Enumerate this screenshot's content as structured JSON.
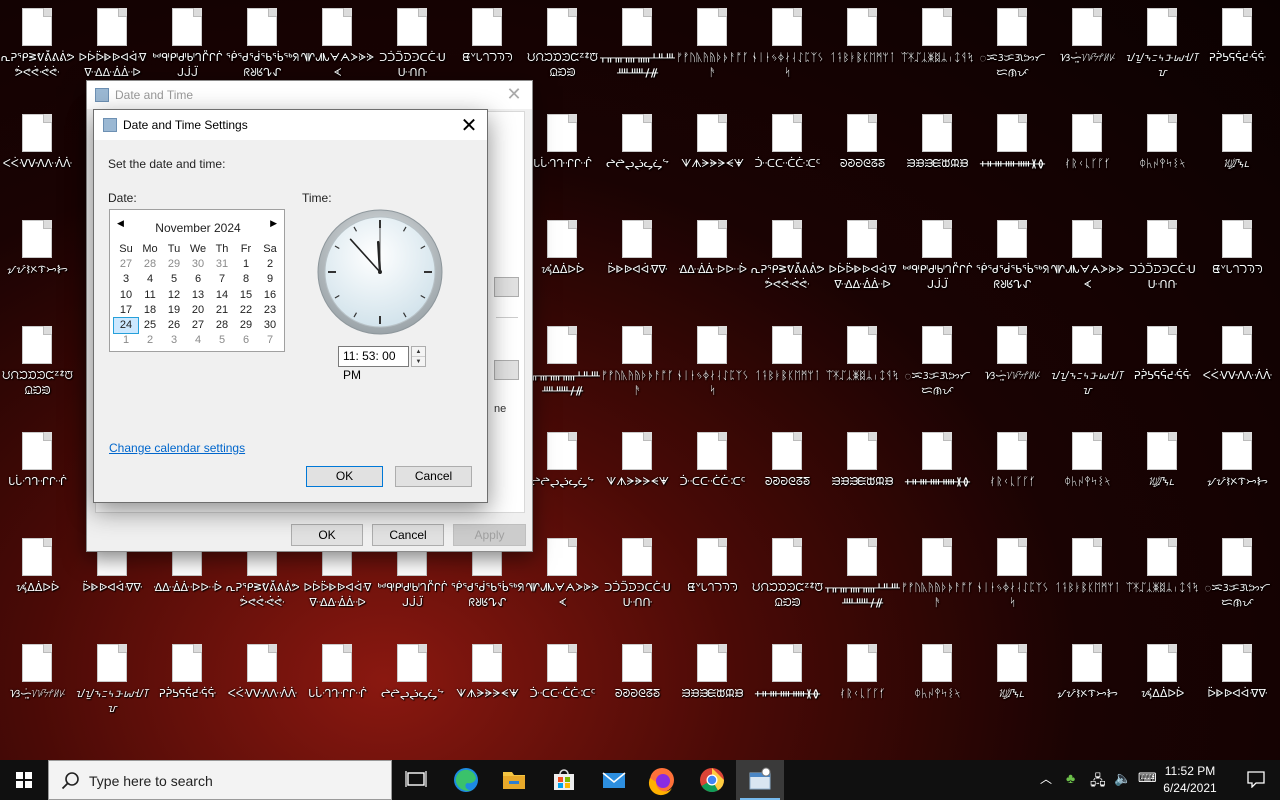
{
  "desktop": {
    "icon_labels": [
      "ᕆᕈᕿᕒᕓᕔᕕᕖᕗᕘᕙᕚᕛᕜ",
      "ᐅᐆᐇᐈᐉᐊᐋᐌᐍᐎᐏᐐᐑᐒ",
      "ᒃᒄᒅᒆᒇᒈᒉᒊᒋᒌᒍᒎᒏ",
      "ᖀᖁᖂᖃᖄᖅᖆᖇᖈᖉᖊᖋ",
      "ᗀᗁᗂᗃᗄᗅᗆᗇᗈᗉ",
      "ᑐᑑᑒᑓᑔᑕᑖᑗᑘᑙᑚ",
      "ᘀᘁᘂᘃᘄᘅᘆ",
      "ᙀᙁᙂᙃᙄᙅᙆᙇᙈᙉᙊᙋ",
      "ᚁᚂᚃᚄᚅᚆᚇᚈᚉᚊᚋᚌ",
      "ᚠᚡᚢᚣᚤᚥᚦᚧᚨᚩᚪᚫ",
      "ᛀᛁᛂᛃᛄᛅᛆᛇᛈᛉᛊᛋ",
      "ᛐᛑᛒᛓᛔᛕᛖᛗᛘᛙ",
      "ᛠᛡᛢᛣᛤᛥᛦᛧᛨᛩᛪ",
      "ᜀᜁᜂᜃᜄᜅᜆᜇᜈᜉ",
      "ᜐᜑᜒᜓ᜔ᜠᜡᜢᜣᜤᜥ",
      "ᝀᝁᝂᝃᝄᝅᝆᝇᝈᝉ",
      "ᕈᕉᕊᕋᕌᕍᕎᕏ",
      "ᐸᐹᐺᐻᐼᐽᐾᐿ",
      "ᒐᒑᒒᒓᒔᒕᒖ",
      "ᖠᖡᖢᖣᖤᖥᖦ",
      "ᗐᗑᗒᗓᗔᗕᗖ",
      "ᑠᑡᑢᑣᑤᑥᑦ",
      "ᘐᘑᘒᘓᘔᘕ",
      "ᙐᙑᙒᙓᙔᙕᙖ",
      "ᚐᚑᚒᚓᚔᚕᚖ",
      "ᚰᚱᚲᚳᚴᚵᚶ",
      "ᛰᛱᛲᛳᛴᛵᛶ",
      "ᜰᜱᜲᜳ᜴ᝐᝑ",
      "ᝠᝡᝢᝣᝤᝥᝦ",
      "ᝰᝲᝳᐃᐄᐅᐆ",
      "ᐇᐈᐉᐊᐋᐌᐍ",
      "ᐎᐏᐐᐑᐒᐓᐔ"
    ]
  },
  "back_window": {
    "title": "Date and Time",
    "partial_text": "ne",
    "ok": "OK",
    "cancel": "Cancel",
    "apply": "Apply"
  },
  "dialog": {
    "title": "Date and Time Settings",
    "instruction": "Set the date and time:",
    "date_label": "Date:",
    "time_label": "Time:",
    "calendar": {
      "month": "November 2024",
      "weekdays": [
        "Su",
        "Mo",
        "Tu",
        "We",
        "Th",
        "Fr",
        "Sa"
      ],
      "weeks": [
        [
          "27",
          "28",
          "29",
          "30",
          "31",
          "1",
          "2"
        ],
        [
          "3",
          "4",
          "5",
          "6",
          "7",
          "8",
          "9"
        ],
        [
          "10",
          "11",
          "12",
          "13",
          "14",
          "15",
          "16"
        ],
        [
          "17",
          "18",
          "19",
          "20",
          "21",
          "22",
          "23"
        ],
        [
          "24",
          "25",
          "26",
          "27",
          "28",
          "29",
          "30"
        ],
        [
          "1",
          "2",
          "3",
          "4",
          "5",
          "6",
          "7"
        ]
      ],
      "selected": "24"
    },
    "time_value": "11: 53: 00 PM",
    "change_calendar_link": "Change calendar settings",
    "ok": "OK",
    "cancel": "Cancel"
  },
  "taskbar": {
    "search_placeholder": "Type here to search",
    "clock_time": "11:52 PM",
    "clock_date": "6/24/2021",
    "apps": [
      "task-view",
      "edge",
      "file-explorer",
      "store",
      "mail",
      "firefox",
      "chrome",
      "control-panel"
    ]
  },
  "colors": {
    "accent": "#0078d7",
    "link": "#0066cc",
    "selection": "#cce8ff"
  }
}
